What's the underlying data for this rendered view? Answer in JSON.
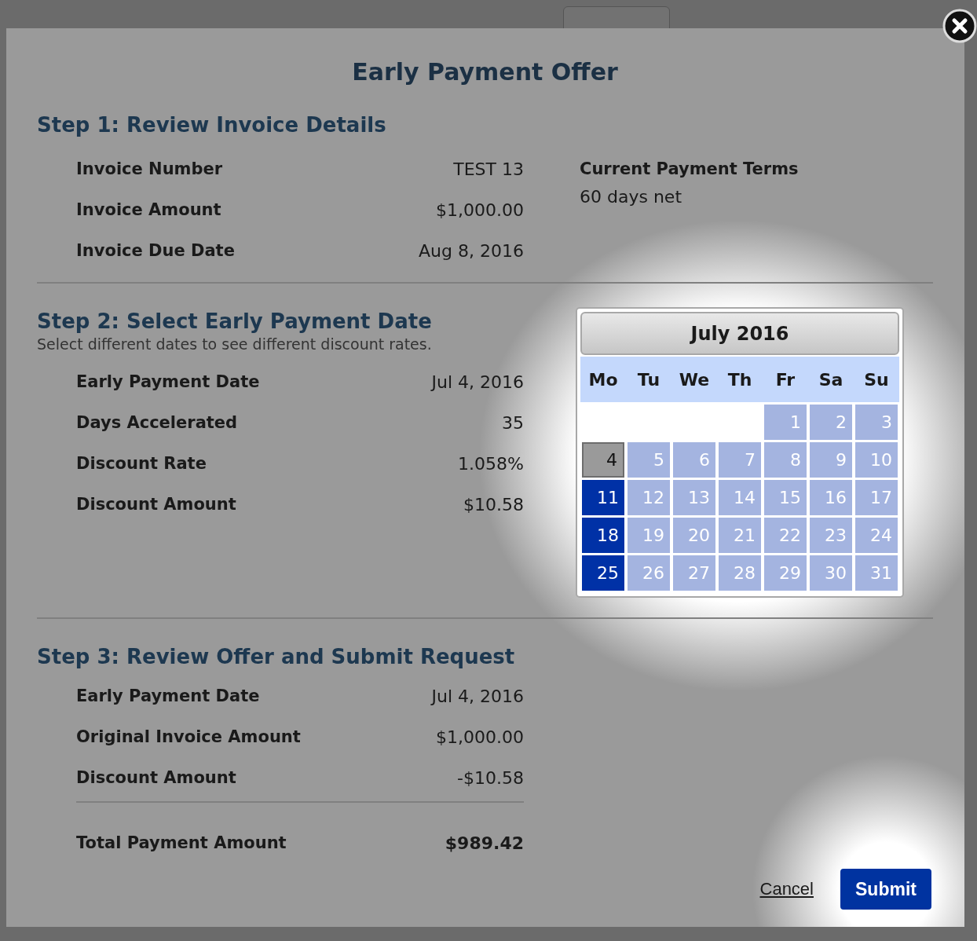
{
  "dialog": {
    "title": "Early Payment Offer"
  },
  "step1": {
    "heading": "Step 1: Review Invoice Details",
    "rows": [
      {
        "label": "Invoice Number",
        "value": "TEST 13"
      },
      {
        "label": "Invoice Amount",
        "value": "$1,000.00"
      },
      {
        "label": "Invoice Due Date",
        "value": "Aug 8, 2016"
      }
    ],
    "terms": {
      "label": "Current Payment Terms",
      "value": "60 days net"
    }
  },
  "step2": {
    "heading": "Step 2: Select Early Payment Date",
    "hint": "Select different dates to see different discount rates.",
    "rows": [
      {
        "label": "Early Payment Date",
        "value": "Jul 4, 2016"
      },
      {
        "label": "Days Accelerated",
        "value": "35"
      },
      {
        "label": "Discount Rate",
        "value": "1.058%"
      },
      {
        "label": "Discount Amount",
        "value": "$10.58"
      }
    ]
  },
  "calendar": {
    "title": "July 2016",
    "weekdays": [
      "Mo",
      "Tu",
      "We",
      "Th",
      "Fr",
      "Sa",
      "Su"
    ],
    "days": [
      {
        "kind": "blank"
      },
      {
        "kind": "blank"
      },
      {
        "kind": "blank"
      },
      {
        "kind": "blank"
      },
      {
        "kind": "open",
        "label": "1",
        "selected": false
      },
      {
        "kind": "open",
        "label": "2",
        "selected": false
      },
      {
        "kind": "open",
        "label": "3",
        "selected": false
      },
      {
        "kind": "open",
        "label": "4",
        "selected": true
      },
      {
        "kind": "open",
        "label": "5",
        "selected": false
      },
      {
        "kind": "open",
        "label": "6",
        "selected": false
      },
      {
        "kind": "open",
        "label": "7",
        "selected": false
      },
      {
        "kind": "open",
        "label": "8",
        "selected": false
      },
      {
        "kind": "open",
        "label": "9",
        "selected": false
      },
      {
        "kind": "open",
        "label": "10",
        "selected": false
      },
      {
        "kind": "blocked",
        "label": "11",
        "selected": false
      },
      {
        "kind": "open",
        "label": "12",
        "selected": false
      },
      {
        "kind": "open",
        "label": "13",
        "selected": false
      },
      {
        "kind": "open",
        "label": "14",
        "selected": false
      },
      {
        "kind": "open",
        "label": "15",
        "selected": false
      },
      {
        "kind": "open",
        "label": "16",
        "selected": false
      },
      {
        "kind": "open",
        "label": "17",
        "selected": false
      },
      {
        "kind": "blocked",
        "label": "18",
        "selected": false
      },
      {
        "kind": "open",
        "label": "19",
        "selected": false
      },
      {
        "kind": "open",
        "label": "20",
        "selected": false
      },
      {
        "kind": "open",
        "label": "21",
        "selected": false
      },
      {
        "kind": "open",
        "label": "22",
        "selected": false
      },
      {
        "kind": "open",
        "label": "23",
        "selected": false
      },
      {
        "kind": "open",
        "label": "24",
        "selected": false
      },
      {
        "kind": "blocked",
        "label": "25",
        "selected": false
      },
      {
        "kind": "open",
        "label": "26",
        "selected": false
      },
      {
        "kind": "open",
        "label": "27",
        "selected": false
      },
      {
        "kind": "open",
        "label": "28",
        "selected": false
      },
      {
        "kind": "open",
        "label": "29",
        "selected": false
      },
      {
        "kind": "open",
        "label": "30",
        "selected": false
      },
      {
        "kind": "open",
        "label": "31",
        "selected": false
      }
    ]
  },
  "step3": {
    "heading": "Step 3: Review Offer and Submit Request",
    "rows": [
      {
        "label": "Early Payment Date",
        "value": "Jul 4, 2016"
      },
      {
        "label": "Original Invoice Amount",
        "value": "$1,000.00"
      },
      {
        "label": "Discount Amount",
        "value": "-$10.58"
      }
    ],
    "total": {
      "label": "Total Payment Amount",
      "value": "$989.42"
    }
  },
  "actions": {
    "cancel": "Cancel",
    "submit": "Submit"
  }
}
